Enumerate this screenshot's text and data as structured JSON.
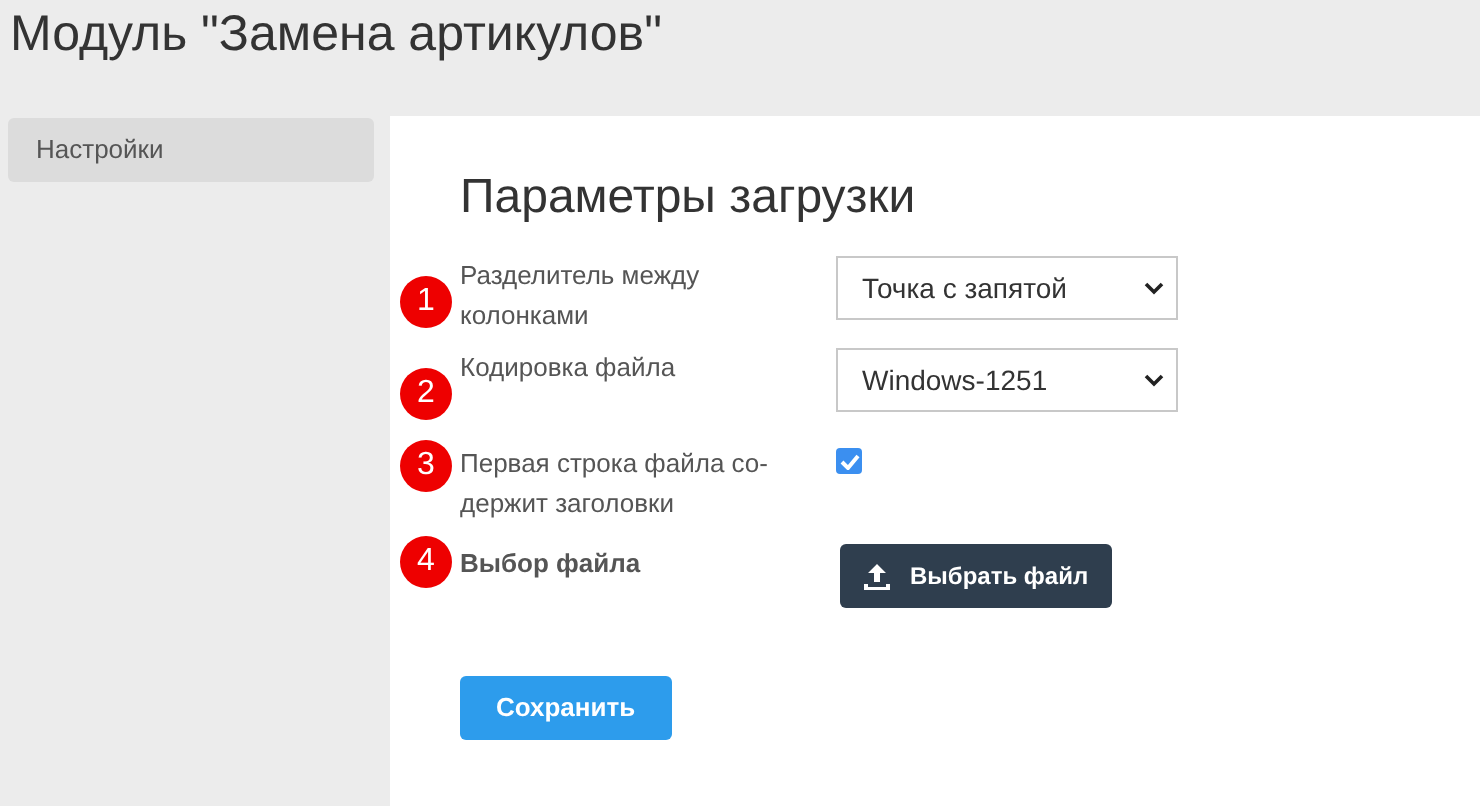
{
  "page_title": "Модуль \"Замена артикулов\"",
  "sidebar": {
    "items": [
      {
        "label": "Настройки",
        "selected": true
      }
    ]
  },
  "form": {
    "title": "Параметры загрузки",
    "fields": [
      {
        "badge": "1",
        "label": "Разделитель между колонками",
        "kind": "select",
        "value": "Точка с запятой"
      },
      {
        "badge": "2",
        "label": "Кодировка файла",
        "kind": "select",
        "value": "Windows-1251"
      },
      {
        "badge": "3",
        "label": "Первая строка файла со-держит заголовки",
        "kind": "checkbox",
        "checked": true
      },
      {
        "badge": "4",
        "label": "Выбор файла",
        "kind": "file",
        "button": "Выбрать файл"
      }
    ],
    "save_button": "Сохранить"
  }
}
